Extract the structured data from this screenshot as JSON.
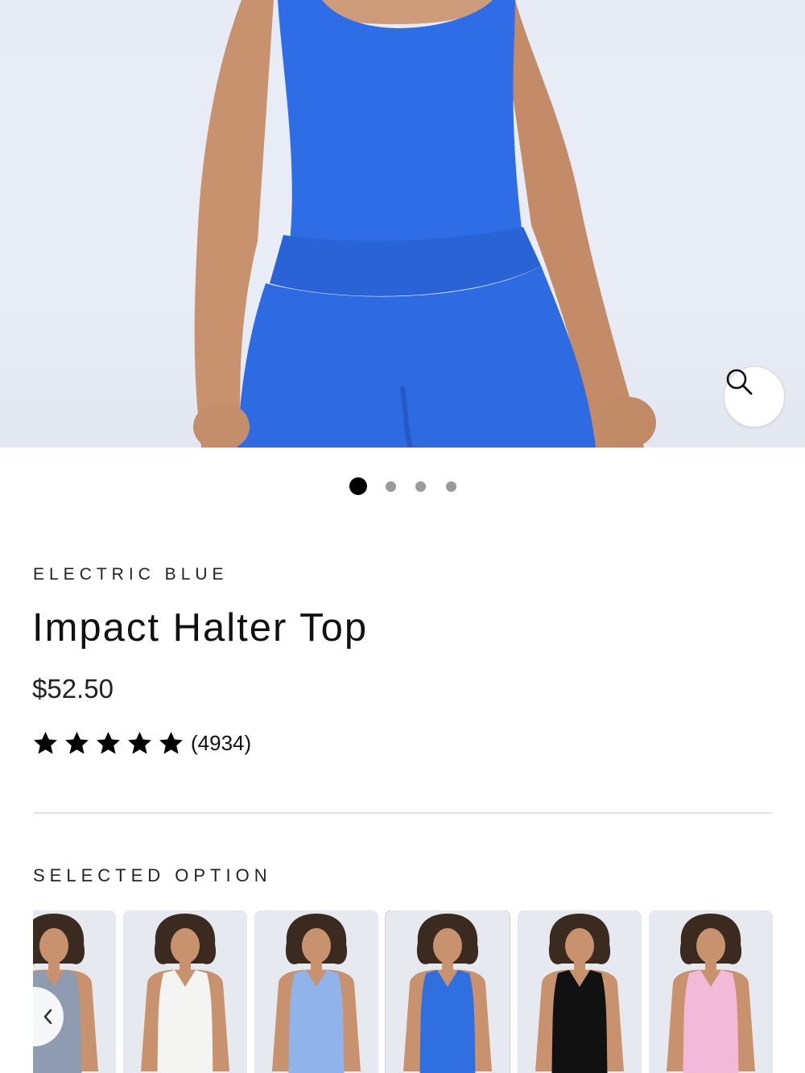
{
  "product": {
    "color_name": "ELECTRIC BLUE",
    "title": "Impact Halter Top",
    "price": "$52.50",
    "rating": {
      "stars": 5,
      "review_count": "(4934)"
    }
  },
  "gallery": {
    "image_count": 4,
    "active_index": 0,
    "zoom_icon": "search-icon"
  },
  "options": {
    "label": "SELECTED OPTION",
    "swatches": [
      {
        "color": "#8e9bb0",
        "name": "grey"
      },
      {
        "color": "#f4f4f2",
        "name": "white"
      },
      {
        "color": "#8fb3ea",
        "name": "light-blue"
      },
      {
        "color": "#2f6fe0",
        "name": "electric-blue",
        "selected": true
      },
      {
        "color": "#111111",
        "name": "black"
      },
      {
        "color": "#f2b9d8",
        "name": "pink"
      }
    ],
    "prev_icon": "chevron-left-icon"
  },
  "colors": {
    "garment_blue": "#2f6de6",
    "skin": "#c99674",
    "background": "#e8ecf5"
  }
}
